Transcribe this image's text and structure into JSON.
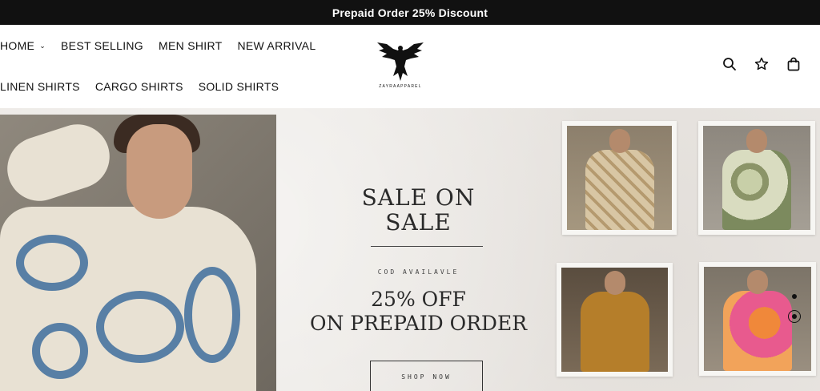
{
  "announcement": {
    "text": "Prepaid Order 25% Discount"
  },
  "nav": {
    "row1": [
      {
        "label": "HOME",
        "has_dropdown": true
      },
      {
        "label": "BEST SELLING"
      },
      {
        "label": "MEN SHIRT"
      },
      {
        "label": "NEW ARRIVAL"
      }
    ],
    "row2": [
      {
        "label": "LINEN SHIRTS"
      },
      {
        "label": "CARGO SHIRTS"
      },
      {
        "label": "SOLID SHIRTS"
      }
    ]
  },
  "logo": {
    "text": "ZAYRAAPPAREL",
    "icon": "eagle-icon"
  },
  "header_icons": [
    {
      "name": "search-icon"
    },
    {
      "name": "wishlist-star-icon"
    },
    {
      "name": "cart-bag-icon"
    }
  ],
  "hero": {
    "title_line1": "SALE ON",
    "title_line2": "SALE",
    "subtitle": "COD AVAILAVLE",
    "offer_line1": "25% OFF",
    "offer_line2": "ON PREPAID ORDER",
    "cta": "SHOP NOW"
  },
  "colors": {
    "announcement_bg": "#111111",
    "hero_bg": "#ebe8e4",
    "octopus_blue": "#3e6d9c"
  }
}
